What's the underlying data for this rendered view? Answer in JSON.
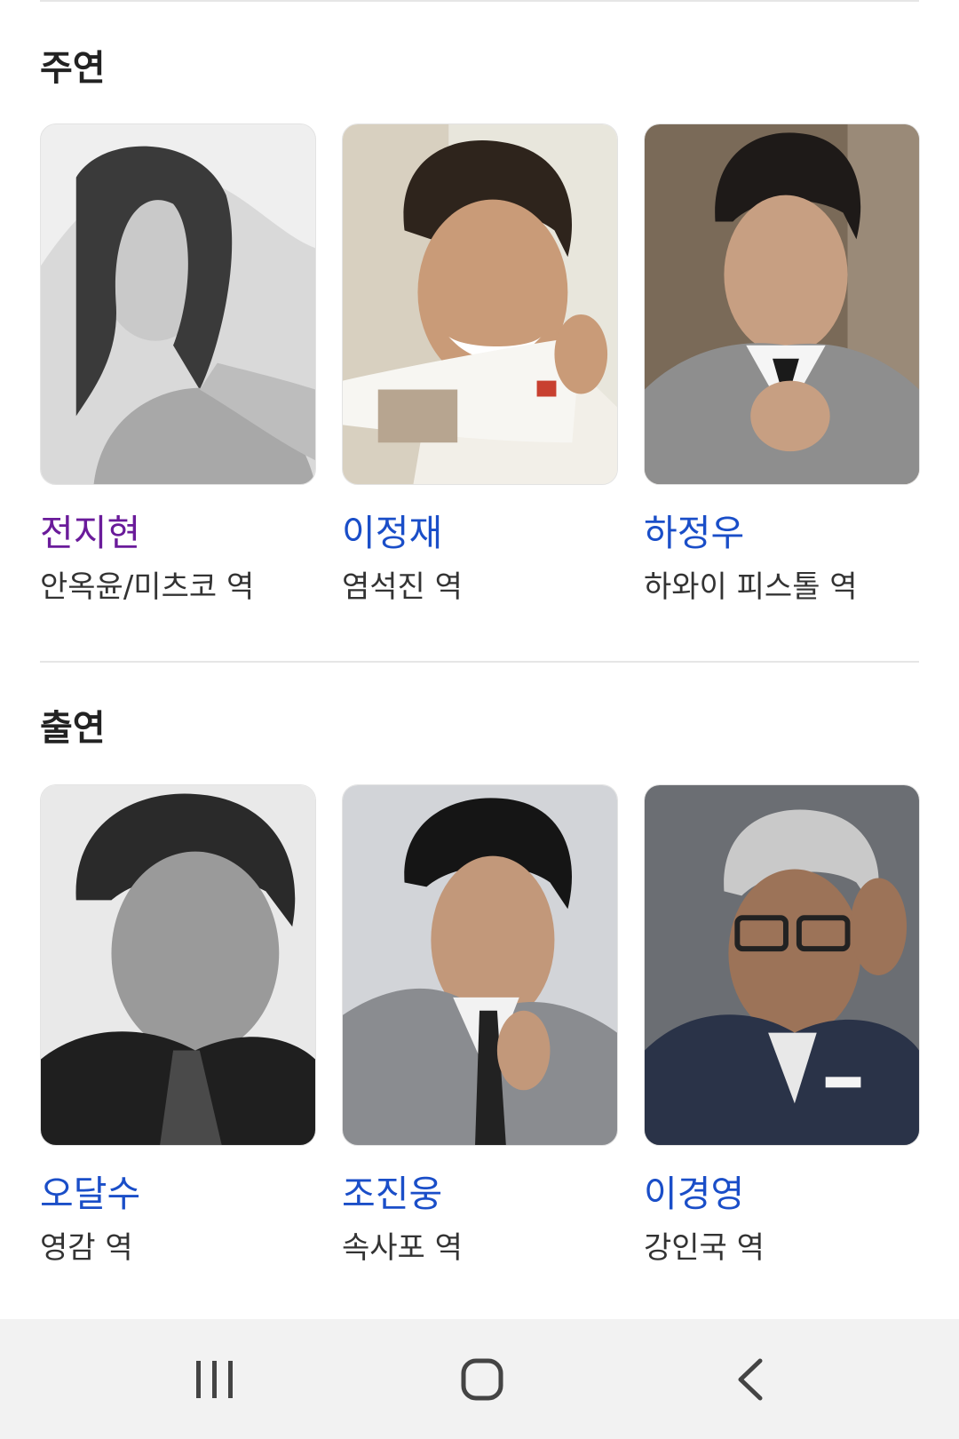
{
  "sections": [
    {
      "title": "주연",
      "cast": [
        {
          "name": "전지현",
          "role": "안옥윤/미츠코 역",
          "visited": true
        },
        {
          "name": "이정재",
          "role": "염석진 역",
          "visited": false
        },
        {
          "name": "하정우",
          "role": "하와이 피스톨 역",
          "visited": false
        }
      ]
    },
    {
      "title": "출연",
      "cast": [
        {
          "name": "오달수",
          "role": "영감 역",
          "visited": false
        },
        {
          "name": "조진웅",
          "role": "속사포 역",
          "visited": false
        },
        {
          "name": "이경영",
          "role": "강인국 역",
          "visited": false
        }
      ]
    }
  ],
  "colors": {
    "link": "#1a4ec8",
    "visited_link": "#6a1b9a",
    "nav_background": "#f2f2f2"
  },
  "nav": {
    "icons": [
      "recent-apps-icon",
      "home-icon",
      "back-icon"
    ]
  }
}
